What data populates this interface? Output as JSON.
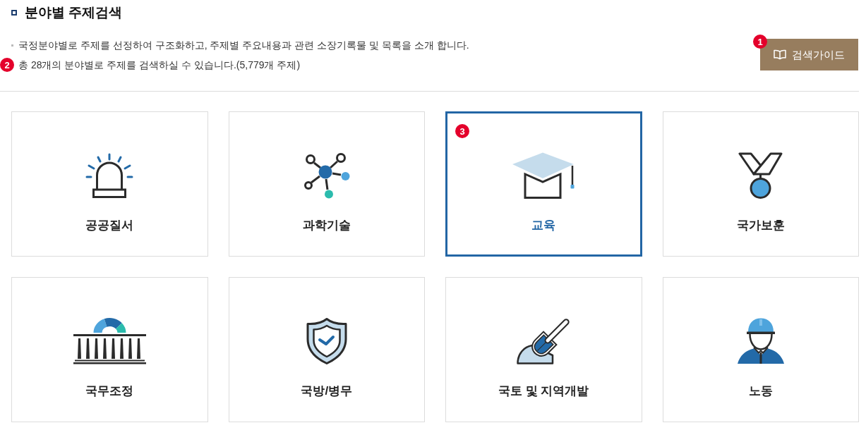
{
  "heading": {
    "title": "분야별 주제검색"
  },
  "description": [
    {
      "text": "국정분야별로 주제를 선정하여 구조화하고, 주제별 주요내용과 관련 소장기록물 및 목록을 소개 합니다."
    },
    {
      "text": "총 28개의 분야별로 주제를 검색하실 수 있습니다.(5,779개 주제)",
      "callout": "2"
    }
  ],
  "guide_button": {
    "label": "검색가이드",
    "callout": "1"
  },
  "categories": [
    {
      "label": "공공질서",
      "kind": "siren",
      "selected": false
    },
    {
      "label": "과학기술",
      "kind": "molecule",
      "selected": false
    },
    {
      "label": "교육",
      "kind": "cap",
      "selected": true,
      "callout": "3"
    },
    {
      "label": "국가보훈",
      "kind": "medal",
      "selected": false
    },
    {
      "label": "국무조정",
      "kind": "building",
      "selected": false
    },
    {
      "label": "국방/병무",
      "kind": "shield",
      "selected": false
    },
    {
      "label": "국토 및 지역개발",
      "kind": "shovel",
      "selected": false
    },
    {
      "label": "노동",
      "kind": "worker",
      "selected": false
    }
  ]
}
